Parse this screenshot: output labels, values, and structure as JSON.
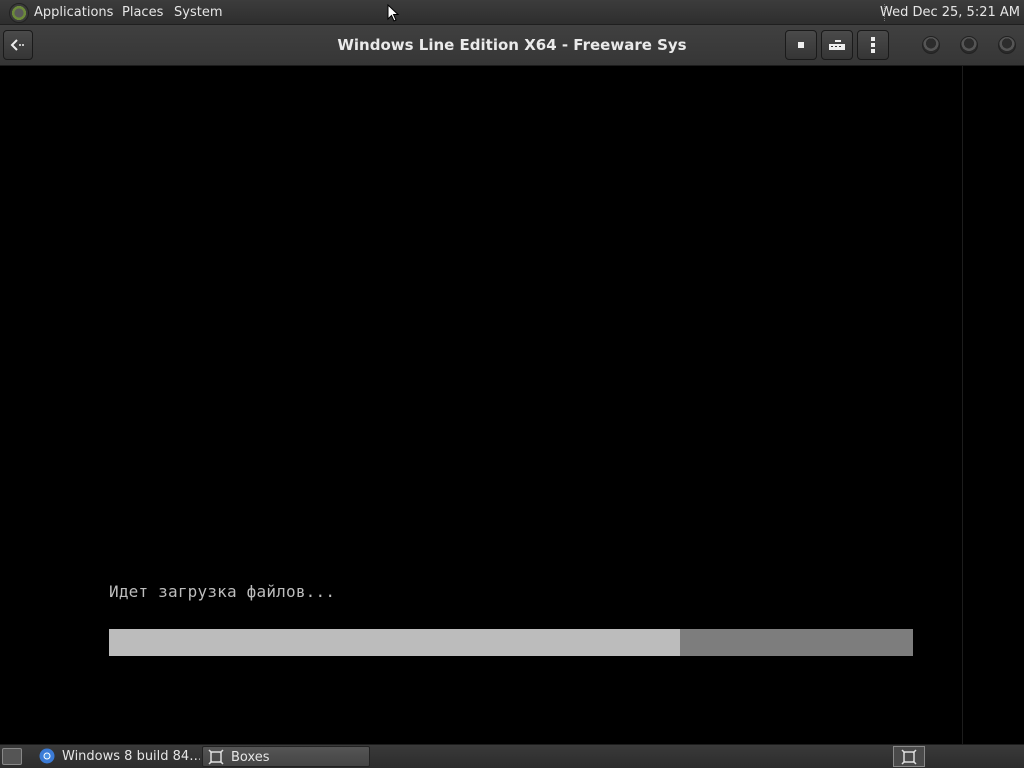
{
  "top_panel": {
    "menus": [
      "Applications",
      "Places",
      "System"
    ],
    "clock": "Wed Dec 25,  5:21 AM"
  },
  "header": {
    "title": "Windows Line Edition X64 - Freeware Sys",
    "icons": {
      "back": "back-arrow-icon",
      "stop": "stop-icon",
      "keys": "keyboard-icon",
      "menu": "kebab-menu-icon"
    }
  },
  "vm": {
    "loading_text": "Идет загрузка файлов...",
    "progress_fraction": 0.71,
    "colors": {
      "fill": "#bcbcbc",
      "track": "#7d7d7d",
      "text": "#bdbdbd"
    }
  },
  "taskbar": {
    "tasks": [
      {
        "label": "Windows 8 build 84…",
        "icon": "chrome-icon"
      },
      {
        "label": "Boxes",
        "icon": "boxes-icon",
        "active": true
      }
    ]
  }
}
